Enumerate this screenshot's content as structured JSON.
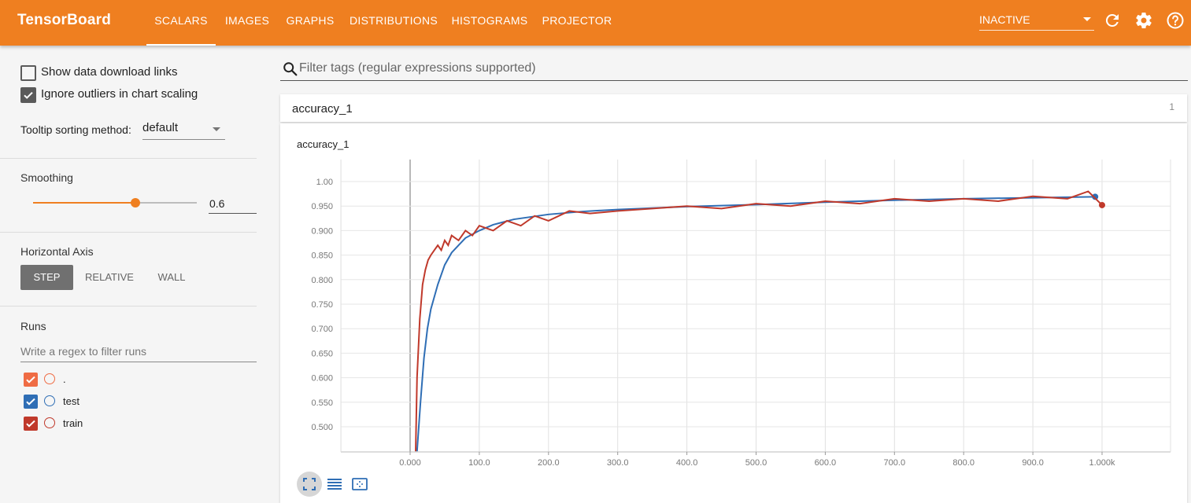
{
  "header": {
    "title": "TensorBoard",
    "tabs": [
      {
        "label": "SCALARS",
        "active": true
      },
      {
        "label": "IMAGES",
        "active": false
      },
      {
        "label": "GRAPHS",
        "active": false
      },
      {
        "label": "DISTRIBUTIONS",
        "active": false
      },
      {
        "label": "HISTOGRAMS",
        "active": false
      },
      {
        "label": "PROJECTOR",
        "active": false
      }
    ],
    "status": "INACTIVE",
    "icons": [
      "refresh-icon",
      "settings-icon",
      "help-icon"
    ],
    "color": "#ef7f20"
  },
  "sidebar": {
    "show_download_links": {
      "label": "Show data download links",
      "checked": false
    },
    "ignore_outliers": {
      "label": "Ignore outliers in chart scaling",
      "checked": true
    },
    "tooltip_sorting": {
      "label": "Tooltip sorting method:",
      "value": "default"
    },
    "smoothing": {
      "title": "Smoothing",
      "value": "0.6",
      "fraction": 0.6
    },
    "horizontal_axis": {
      "title": "Horizontal Axis",
      "options": [
        "STEP",
        "RELATIVE",
        "WALL"
      ],
      "selected": "STEP"
    },
    "runs": {
      "title": "Runs",
      "filter_placeholder": "Write a regex to filter runs",
      "items": [
        {
          "label": ".",
          "color": "#ef6c44",
          "checked": true
        },
        {
          "label": "test",
          "color": "#2f6eb5",
          "checked": true
        },
        {
          "label": "train",
          "color": "#c0392b",
          "checked": true
        }
      ]
    }
  },
  "main": {
    "filter_placeholder": "Filter tags (regular expressions supported)",
    "category": {
      "name": "accuracy_1",
      "count": "1"
    },
    "card_title": "accuracy_1",
    "chart_buttons": [
      "fit-domain-icon",
      "log-scale-icon",
      "zoom-selection-icon"
    ]
  },
  "chart_data": {
    "type": "line",
    "title": "accuracy_1",
    "x_ticks": [
      "0.000",
      "100.0",
      "200.0",
      "300.0",
      "400.0",
      "500.0",
      "600.0",
      "700.0",
      "800.0",
      "900.0",
      "1.000k"
    ],
    "y_ticks": [
      "1.00",
      "0.950",
      "0.900",
      "0.850",
      "0.800",
      "0.750",
      "0.700",
      "0.650",
      "0.600",
      "0.550",
      "0.500"
    ],
    "xlim": [
      -100,
      1100
    ],
    "ylim": [
      0.45,
      1.0
    ],
    "grid": true,
    "series": [
      {
        "color": "#2f6eb5",
        "x": [
          10,
          15,
          20,
          25,
          30,
          40,
          50,
          60,
          70,
          80,
          100,
          120,
          150,
          200,
          250,
          300,
          400,
          500,
          600,
          700,
          800,
          900,
          990
        ],
        "y": [
          0.45,
          0.55,
          0.64,
          0.7,
          0.74,
          0.79,
          0.83,
          0.855,
          0.87,
          0.885,
          0.9,
          0.912,
          0.923,
          0.933,
          0.939,
          0.943,
          0.949,
          0.953,
          0.958,
          0.962,
          0.965,
          0.967,
          0.969
        ]
      },
      {
        "color": "#c0392b",
        "x": [
          8,
          10,
          14,
          18,
          22,
          26,
          30,
          35,
          40,
          45,
          50,
          55,
          60,
          70,
          80,
          90,
          100,
          120,
          140,
          160,
          180,
          200,
          230,
          260,
          300,
          350,
          400,
          450,
          500,
          550,
          600,
          650,
          700,
          750,
          800,
          850,
          900,
          950,
          980,
          1000
        ],
        "y": [
          0.45,
          0.6,
          0.72,
          0.79,
          0.82,
          0.84,
          0.85,
          0.86,
          0.87,
          0.86,
          0.88,
          0.87,
          0.89,
          0.88,
          0.9,
          0.89,
          0.91,
          0.9,
          0.92,
          0.91,
          0.93,
          0.92,
          0.94,
          0.935,
          0.94,
          0.945,
          0.95,
          0.945,
          0.955,
          0.95,
          0.96,
          0.955,
          0.965,
          0.96,
          0.965,
          0.96,
          0.97,
          0.965,
          0.98,
          0.952
        ]
      }
    ]
  }
}
